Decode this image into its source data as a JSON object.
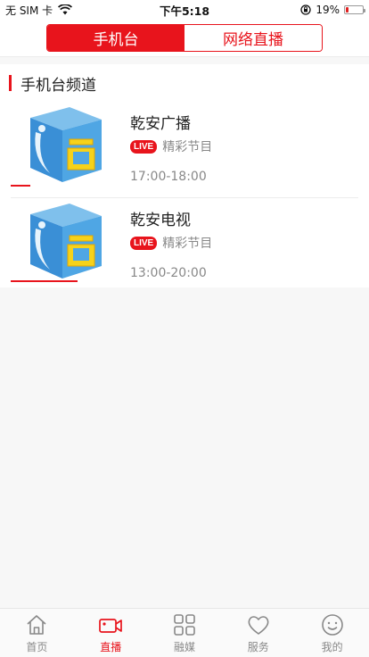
{
  "status_bar": {
    "carrier": "无 SIM 卡",
    "time": "下午5:18",
    "battery": "19%",
    "battery_level": 0.19
  },
  "header": {
    "tabs": [
      {
        "label": "手机台",
        "active": true
      },
      {
        "label": "网络直播",
        "active": false
      }
    ]
  },
  "section": {
    "title": "手机台频道"
  },
  "channels": [
    {
      "name": "乾安广播",
      "badge": "LIVE",
      "program": "精彩节目",
      "time": "17:00-18:00",
      "progress": 0.2
    },
    {
      "name": "乾安电视",
      "badge": "LIVE",
      "program": "精彩节目",
      "time": "13:00-20:00",
      "progress": 0.68
    }
  ],
  "tabbar": {
    "items": [
      {
        "label": "首页",
        "icon": "home-icon",
        "active": false
      },
      {
        "label": "直播",
        "icon": "video-camera-icon",
        "active": true
      },
      {
        "label": "融媒",
        "icon": "grid-icon",
        "active": false
      },
      {
        "label": "服务",
        "icon": "heart-icon",
        "active": false
      },
      {
        "label": "我的",
        "icon": "smiley-icon",
        "active": false
      }
    ]
  },
  "colors": {
    "accent": "#e8141c"
  }
}
